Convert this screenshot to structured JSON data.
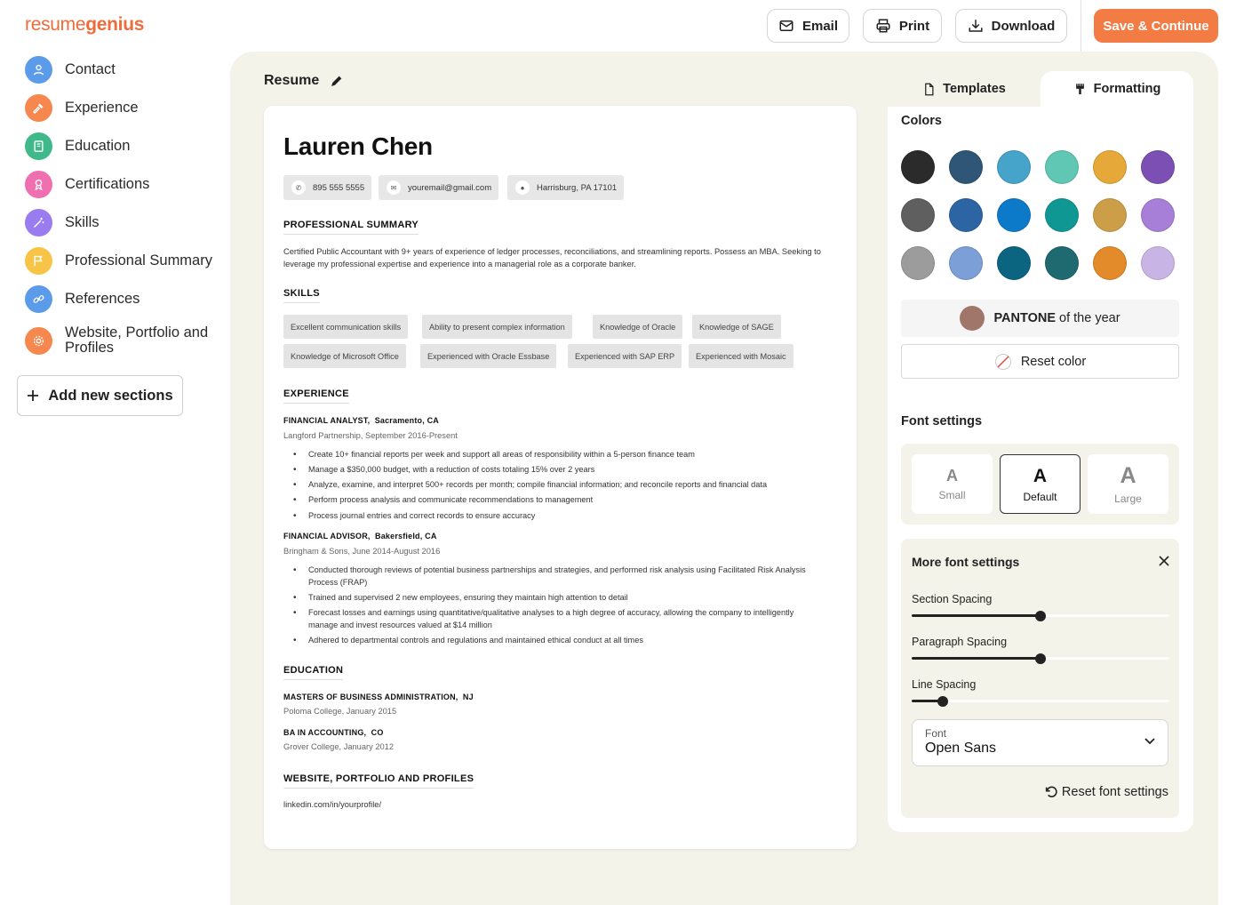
{
  "header": {
    "logo_light": "resume",
    "logo_bold": "genius",
    "email_label": "Email",
    "print_label": "Print",
    "download_label": "Download",
    "save_label": "Save & Continue"
  },
  "sidebar": {
    "items": [
      {
        "label": "Contact",
        "color": "#5b9bea",
        "icon": "person-icon"
      },
      {
        "label": "Experience",
        "color": "#f5874f",
        "icon": "hammer-icon"
      },
      {
        "label": "Education",
        "color": "#3fb88a",
        "icon": "book-icon"
      },
      {
        "label": "Certifications",
        "color": "#f06fb0",
        "icon": "award-icon"
      },
      {
        "label": "Skills",
        "color": "#9b7cf0",
        "icon": "wand-icon"
      },
      {
        "label": "Professional Summary",
        "color": "#f7c447",
        "icon": "flag-icon"
      },
      {
        "label": "References",
        "color": "#5b9bea",
        "icon": "link-icon"
      },
      {
        "label": "Website, Portfolio and Profiles",
        "color": "#f5874f",
        "icon": "gear-icon"
      }
    ],
    "add_sections_label": "Add new sections"
  },
  "main": {
    "title": "Resume"
  },
  "resume": {
    "name": "Lauren Chen",
    "phone": "895 555 5555",
    "email": "youremail@gmail.com",
    "location": "Harrisburg, PA 17101",
    "summary_heading": "PROFESSIONAL SUMMARY",
    "summary_text": "Certified Public Accountant with 9+ years of experience of ledger processes, reconciliations, and streamlining reports. Possess an MBA. Seeking to leverage my professional expertise and experience into a managerial role as a corporate banker.",
    "skills_heading": "SKILLS",
    "skills_row1": [
      "Excellent communication skills",
      "Ability to present complex information",
      "Knowledge of Oracle",
      "Knowledge of SAGE"
    ],
    "skills_row2": [
      "Knowledge of Microsoft Office",
      "Experienced with Oracle Essbase",
      "Experienced with SAP ERP",
      "Experienced with Mosaic"
    ],
    "experience_heading": "EXPERIENCE",
    "jobs": [
      {
        "title": "FINANCIAL ANALYST,",
        "location": "Sacramento, CA",
        "sub": "Langford Partnership,  September 2016-Present",
        "bullets": [
          "Create 10+ financial reports per week and support all areas of responsibility within a 5-person finance team",
          "Manage a $350,000 budget, with a reduction of costs totaling 15% over 2 years",
          "Analyze, examine, and interpret 500+ records per month; compile financial information; and reconcile reports and financial data",
          "Perform process analysis and communicate recommendations to management",
          "Process journal entries and correct records to ensure accuracy"
        ]
      },
      {
        "title": "FINANCIAL ADVISOR,",
        "location": "Bakersfield, CA",
        "sub": "Bringham & Sons,  June 2014-August 2016",
        "bullets": [
          "Conducted thorough reviews of potential business partnerships and strategies, and performed risk analysis using Facilitated Risk Analysis Process (FRAP)",
          "Trained and supervised 2 new employees, ensuring they maintain high attention to detail",
          "Forecast losses and earnings using quantitative/qualitative analyses to a high degree of accuracy, allowing the company to intelligently manage and invest resources valued at $14 million",
          "Adhered to departmental controls and regulations and maintained ethical conduct at all times"
        ]
      }
    ],
    "education_heading": "EDUCATION",
    "education": [
      {
        "degree": "MASTERS OF BUSINESS ADMINISTRATION,",
        "location": "NJ",
        "sub": "Poloma College,   January 2015"
      },
      {
        "degree": "BA IN ACCOUNTING,",
        "location": "CO",
        "sub": "Grover College,   January 2012"
      }
    ],
    "website_heading": "WEBSITE, PORTFOLIO AND PROFILES",
    "website_link": "linkedin.com/in/yourprofile/"
  },
  "panel": {
    "tab_templates": "Templates",
    "tab_formatting": "Formatting",
    "colors_heading": "Colors",
    "colors": [
      [
        "#2b2b2b",
        "#2f5676",
        "#46a3c9",
        "#5fc7b3",
        "#e6a838",
        "#7b4fb3"
      ],
      [
        "#5f5f5f",
        "#2c64a4",
        "#0d7ac9",
        "#0f9893",
        "#cc9e48",
        "#a77fd8"
      ],
      [
        "#9c9c9c",
        "#7b9fd6",
        "#0b6580",
        "#1f6971",
        "#e38a2a",
        "#c9b4e6"
      ]
    ],
    "pantone_bold": "PANTONE",
    "pantone_rest": "of the year",
    "pantone_color": "#a0766a",
    "reset_color_label": "Reset color",
    "font_settings_heading": "Font settings",
    "font_sizes": [
      "Small",
      "Default",
      "Large"
    ],
    "font_size_selected": "Default",
    "more_font_heading": "More font settings",
    "sliders": [
      {
        "label": "Section Spacing",
        "value": 0.5
      },
      {
        "label": "Paragraph Spacing",
        "value": 0.5
      },
      {
        "label": "Line Spacing",
        "value": 0.12
      }
    ],
    "font_label": "Font",
    "font_value": "Open Sans",
    "reset_font_label": "Reset font settings"
  }
}
